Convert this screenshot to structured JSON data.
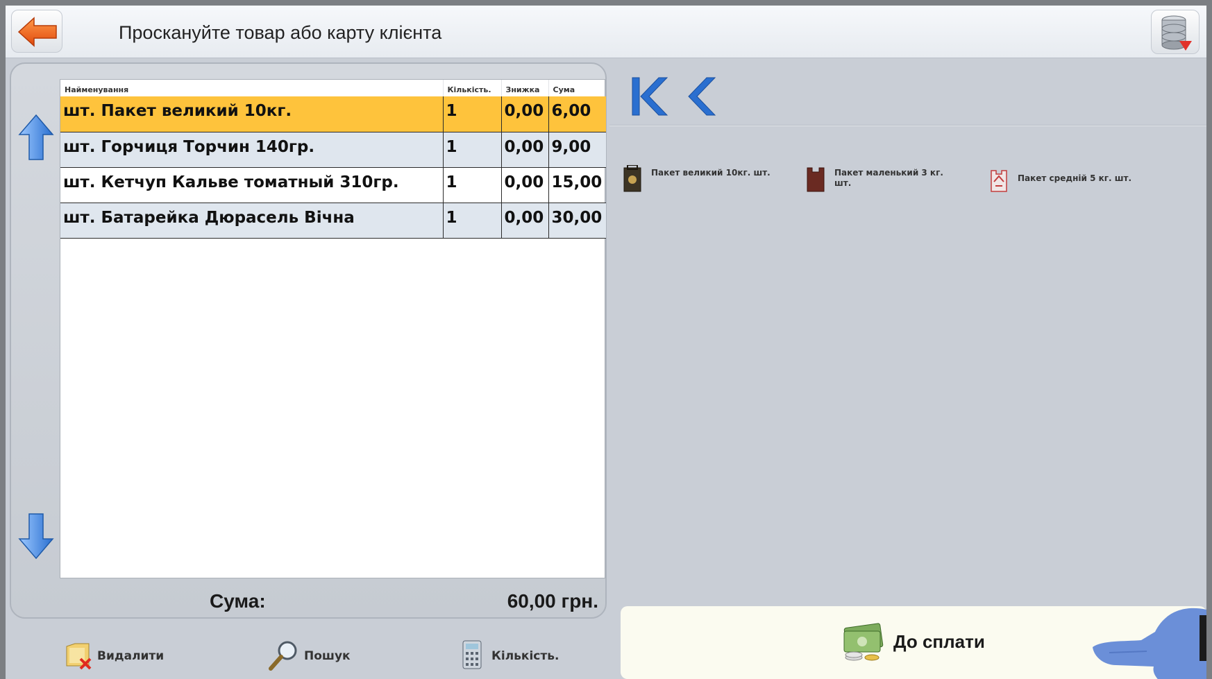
{
  "header": {
    "prompt": "Проскануйте товар або карту клієнта",
    "back_icon": "arrow-left-icon",
    "db_icon": "database-icon"
  },
  "receipt": {
    "columns": [
      "Найменування",
      "Кількість.",
      "Знижка",
      "Сума"
    ],
    "rows": [
      {
        "name": "шт. Пакет великий 10кг.",
        "qty": "1",
        "discount": "0,00",
        "sum": "6,00",
        "selected": true
      },
      {
        "name": "шт. Горчиця  Торчин 140гр.",
        "qty": "1",
        "discount": "0,00",
        "sum": "9,00"
      },
      {
        "name": "шт. Кетчуп Кальве томатный 310гр.",
        "qty": "1",
        "discount": "0,00",
        "sum": "15,00"
      },
      {
        "name": "шт. Батарейка Дюрасель Вічна",
        "qty": "1",
        "discount": "0,00",
        "sum": "30,00"
      }
    ],
    "total_label": "Сума:",
    "total_value": "60,00 грн."
  },
  "toolbar": {
    "delete_label": "Видалити",
    "search_label": "Пошук",
    "qty_label": "Кількість."
  },
  "quick_items": [
    {
      "label": "Пакет великий 10кг. шт.",
      "icon": "bag-large-icon"
    },
    {
      "label": "Пакет маленький 3 кг. шт.",
      "icon": "bag-small-icon"
    },
    {
      "label": "Пакет средній 5 кг. шт.",
      "icon": "bag-medium-icon"
    }
  ],
  "pay": {
    "label": "До сплати",
    "icon": "money-icon"
  },
  "colors": {
    "selected_row": "#fec33c",
    "alt_row": "#dfe6ee",
    "nav_blue": "#2a6fd0",
    "panel_bg": "#c9ced6"
  }
}
